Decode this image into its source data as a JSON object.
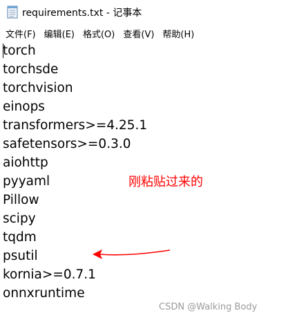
{
  "window": {
    "title": "requirements.txt - 记事本",
    "icon": "notepad-icon"
  },
  "menubar": {
    "items": [
      {
        "label": "文件(F)"
      },
      {
        "label": "编辑(E)"
      },
      {
        "label": "格式(O)"
      },
      {
        "label": "查看(V)"
      },
      {
        "label": "帮助(H)"
      }
    ]
  },
  "editor": {
    "lines": [
      "torch",
      "torchsde",
      "torchvision",
      "einops",
      "transformers>=4.25.1",
      "safetensors>=0.3.0",
      "aiohttp",
      "pyyaml",
      "Pillow",
      "scipy",
      "tqdm",
      "psutil",
      "kornia>=0.7.1",
      "onnxruntime"
    ]
  },
  "annotation": {
    "text": "刚粘贴过来的",
    "color": "#ff0000",
    "arrow_icon": "red-arrow-left-icon"
  },
  "watermark": {
    "text": "CSDN @Walking Body"
  }
}
